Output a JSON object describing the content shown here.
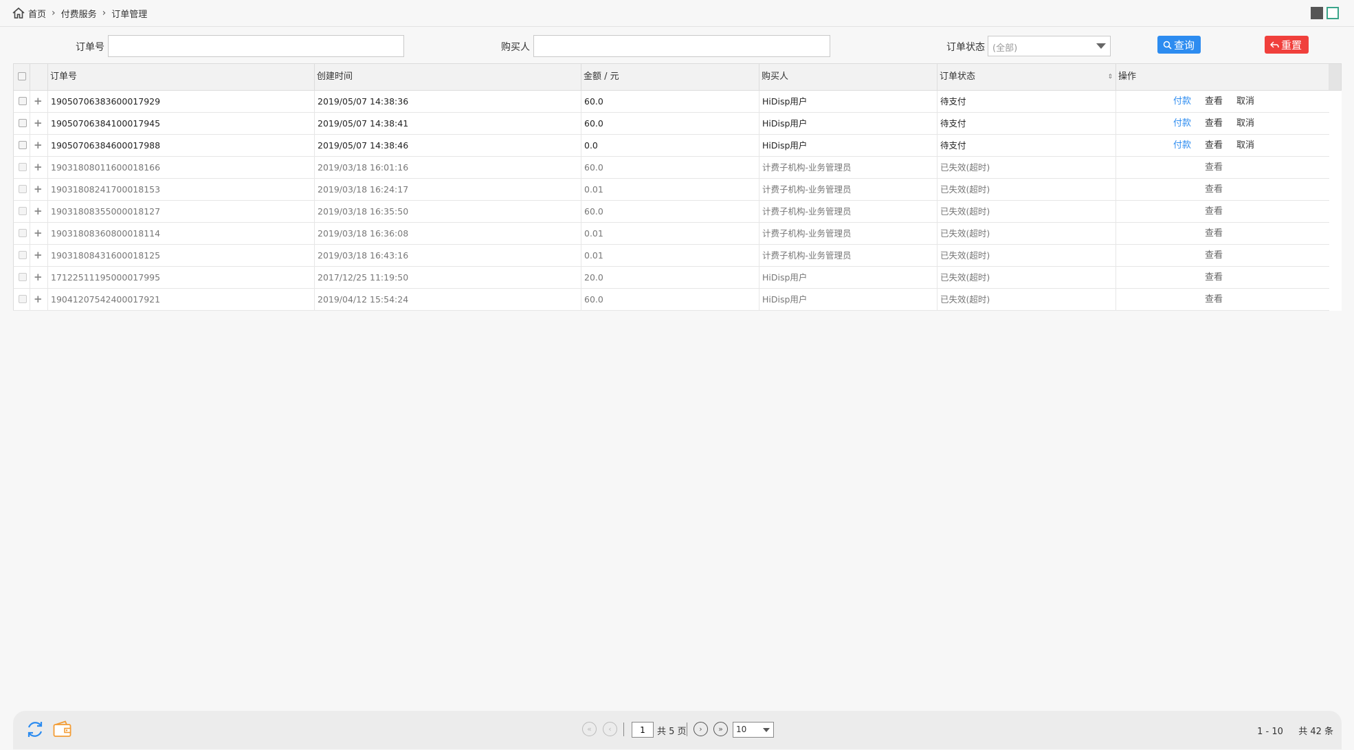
{
  "breadcrumb": {
    "home": "首页",
    "level1": "付费服务",
    "level2": "订单管理"
  },
  "search": {
    "order_no_label": "订单号",
    "order_no_value": "",
    "buyer_label": "购买人",
    "buyer_value": "",
    "status_label": "订单状态",
    "status_selected": "(全部)",
    "query_label": "查询",
    "reset_label": "重置"
  },
  "table": {
    "headers": {
      "order_no": "订单号",
      "created": "创建时间",
      "amount": "金额 / 元",
      "buyer": "购买人",
      "status": "订单状态",
      "actions": "操作"
    },
    "action_labels": {
      "pay": "付款",
      "view": "查看",
      "cancel": "取消"
    },
    "rows": [
      {
        "order_no": "19050706383600017929",
        "created": "2019/05/07 14:38:36",
        "amount": "60.0",
        "buyer": "HiDisp用户",
        "status": "待支付",
        "state": "active"
      },
      {
        "order_no": "19050706384100017945",
        "created": "2019/05/07 14:38:41",
        "amount": "60.0",
        "buyer": "HiDisp用户",
        "status": "待支付",
        "state": "active"
      },
      {
        "order_no": "19050706384600017988",
        "created": "2019/05/07 14:38:46",
        "amount": "0.0",
        "buyer": "HiDisp用户",
        "status": "待支付",
        "state": "active"
      },
      {
        "order_no": "19031808011600018166",
        "created": "2019/03/18 16:01:16",
        "amount": "60.0",
        "buyer": "计费子机构-业务管理员",
        "status": "已失效(超时)",
        "state": "expired"
      },
      {
        "order_no": "19031808241700018153",
        "created": "2019/03/18 16:24:17",
        "amount": "0.01",
        "buyer": "计费子机构-业务管理员",
        "status": "已失效(超时)",
        "state": "expired"
      },
      {
        "order_no": "19031808355000018127",
        "created": "2019/03/18 16:35:50",
        "amount": "60.0",
        "buyer": "计费子机构-业务管理员",
        "status": "已失效(超时)",
        "state": "expired"
      },
      {
        "order_no": "19031808360800018114",
        "created": "2019/03/18 16:36:08",
        "amount": "0.01",
        "buyer": "计费子机构-业务管理员",
        "status": "已失效(超时)",
        "state": "expired"
      },
      {
        "order_no": "19031808431600018125",
        "created": "2019/03/18 16:43:16",
        "amount": "0.01",
        "buyer": "计费子机构-业务管理员",
        "status": "已失效(超时)",
        "state": "expired"
      },
      {
        "order_no": "17122511195000017995",
        "created": "2017/12/25 11:19:50",
        "amount": "20.0",
        "buyer": "HiDisp用户",
        "status": "已失效(超时)",
        "state": "expired"
      },
      {
        "order_no": "19041207542400017921",
        "created": "2019/04/12 15:54:24",
        "amount": "60.0",
        "buyer": "HiDisp用户",
        "status": "已失效(超时)",
        "state": "expired"
      }
    ]
  },
  "pager": {
    "current_page": "1",
    "total_pages_text": "共 5 页",
    "page_size": "10",
    "range_text": "1 - 10",
    "total_text": "共 42 条"
  },
  "colors": {
    "accent_blue": "#2d8cf0",
    "danger_red": "#f0403c"
  }
}
